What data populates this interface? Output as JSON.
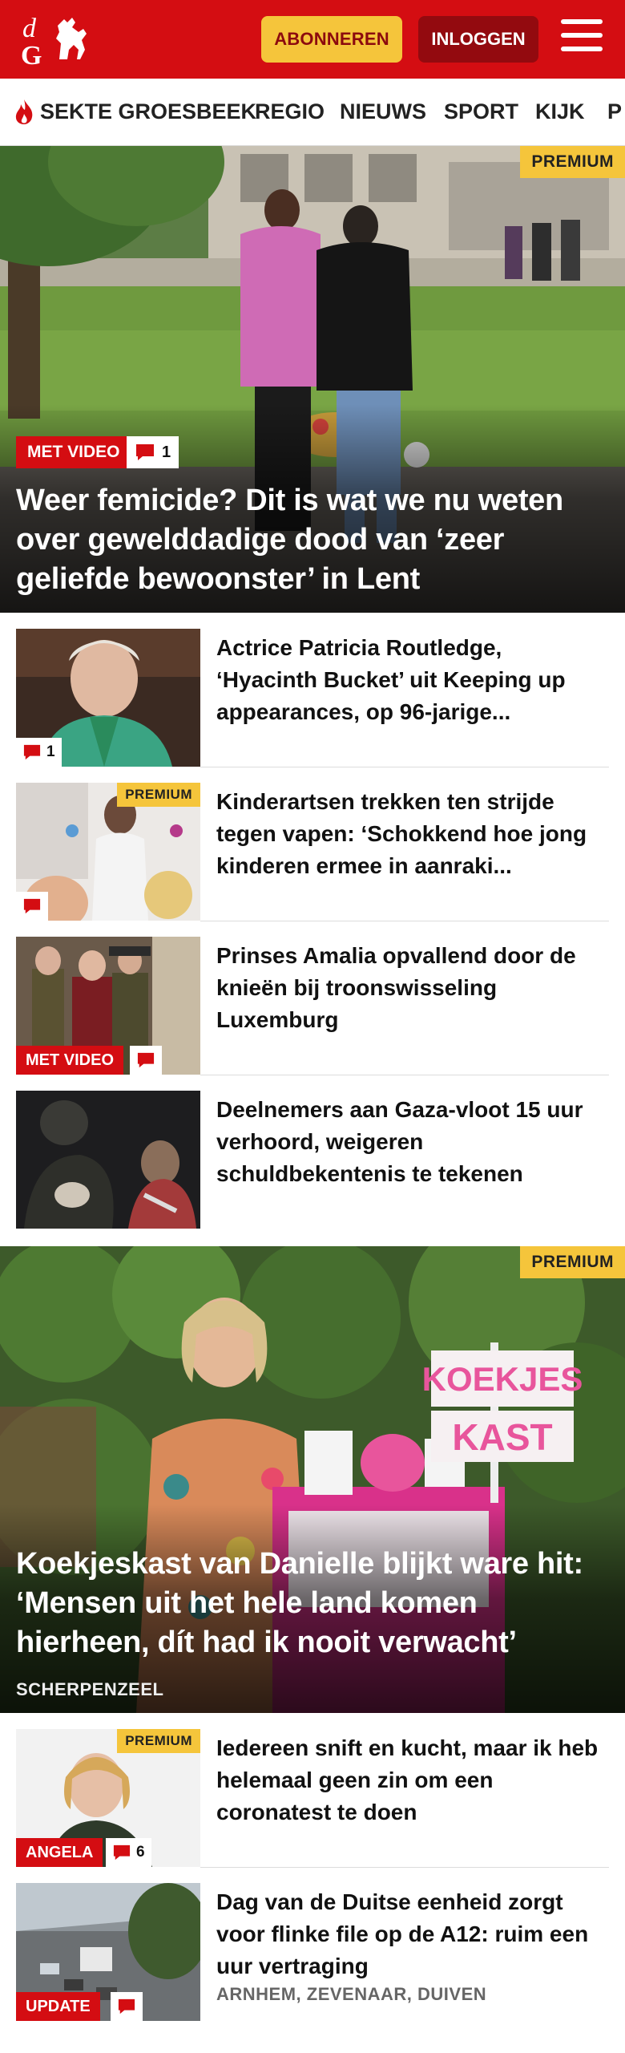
{
  "header": {
    "logo_letters": "dG",
    "subscribe_label": "ABONNEREN",
    "login_label": "INLOGGEN"
  },
  "nav": {
    "items": [
      "SEKTE GROESBEEK",
      "REGIO",
      "NIEUWS",
      "SPORT",
      "KIJK",
      "P"
    ]
  },
  "hero1": {
    "premium": "PREMIUM",
    "video_label": "MET VIDEO",
    "comments": "1",
    "title": "Weer femicide? Dit is wat we nu weten over gewelddadige dood van ‘zeer geliefde bewoonster’ in Lent"
  },
  "articles": [
    {
      "title": "Actrice Patricia Routledge, ‘Hyacinth Bucket’ uit Keeping up appearances, op 96-jarige...",
      "comments": "1"
    },
    {
      "title": "Kinderartsen trekken ten strijde tegen vapen: ‘Schokkend hoe jong kinderen ermee in aanraki...",
      "premium": "PREMIUM"
    },
    {
      "title": "Prinses Amalia opvallend door de knieën bij troonswisseling Luxemburg",
      "badge": "MET VIDEO"
    },
    {
      "title": "Deelnemers aan Gaza-vloot 15 uur verhoord, weigeren schuldbekentenis te tekenen"
    }
  ],
  "hero2": {
    "premium": "PREMIUM",
    "sign_text_1": "KOEKJES",
    "sign_text_2": "KAST",
    "title": "Koekjeskast van Danielle blijkt ware hit: ‘Mensen uit het hele land komen hierheen, dít had ik nooit verwacht’",
    "place": "SCHERPENZEEL"
  },
  "articles2": [
    {
      "title": "Iedereen snift en kucht, maar ik heb helemaal geen zin om een coronatest te doen",
      "premium": "PREMIUM",
      "badge": "ANGELA",
      "comments": "6"
    },
    {
      "title": "Dag van de Duitse eenheid zorgt voor flinke file op de A12: ruim een uur vertraging",
      "badge": "UPDATE",
      "place": "ARNHEM, ZEVENAAR, DUIVEN"
    }
  ]
}
